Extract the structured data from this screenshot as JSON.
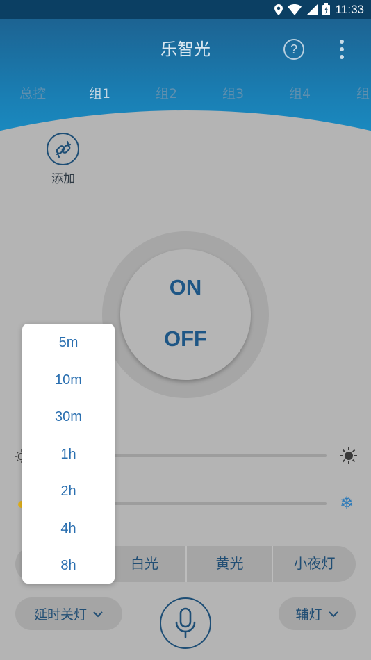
{
  "status_bar": {
    "time": "11:33",
    "icons": [
      "location-icon",
      "wifi-icon",
      "cell-signal-icon",
      "battery-icon"
    ]
  },
  "header": {
    "title": "乐智光",
    "help_label": "?",
    "tabs": [
      {
        "label": "总控",
        "active": false
      },
      {
        "label": "组1",
        "active": true
      },
      {
        "label": "组2",
        "active": false
      },
      {
        "label": "组3",
        "active": false
      },
      {
        "label": "组4",
        "active": false
      },
      {
        "label": "组",
        "active": false
      }
    ]
  },
  "add_button": {
    "label": "添加",
    "icon": "link-icon"
  },
  "power": {
    "on_label": "ON",
    "off_label": "OFF"
  },
  "sliders": {
    "brightness": {
      "left_icon": "sun-dim-icon",
      "right_icon": "sun-bright-icon"
    },
    "color_temp": {
      "left_icon": "warm-light-icon",
      "right_icon": "snowflake-icon"
    }
  },
  "modes": [
    "白光",
    "黄光",
    "小夜灯"
  ],
  "bottom": {
    "delay_label": "延时关灯",
    "aux_label": "辅灯",
    "mic_icon": "microphone-icon"
  },
  "delay_options": [
    "5m",
    "10m",
    "30m",
    "1h",
    "2h",
    "4h",
    "8h"
  ],
  "colors": {
    "status_bar": "#0b3f63",
    "header": "#1a7fb4",
    "accent": "#1e5685",
    "popup_text": "#2a6fb0",
    "overlay_bg": "#b4b4b4"
  }
}
